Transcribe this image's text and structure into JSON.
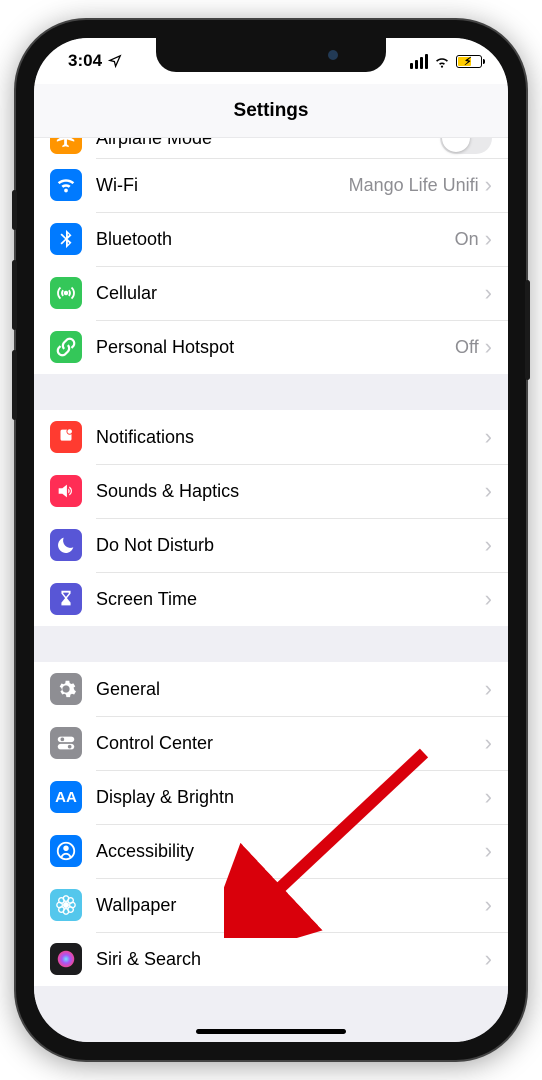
{
  "status": {
    "time": "3:04"
  },
  "nav": {
    "title": "Settings"
  },
  "groups": [
    {
      "rows": [
        {
          "id": "airplane-mode",
          "label": "Airplane Mode",
          "icon": "airplane",
          "bg": "#ff9500",
          "type": "toggle",
          "toggle_on": false,
          "cut": "top"
        },
        {
          "id": "wifi",
          "label": "Wi-Fi",
          "icon": "wifi",
          "bg": "#007aff",
          "type": "nav",
          "value": "Mango Life Unifi"
        },
        {
          "id": "bluetooth",
          "label": "Bluetooth",
          "icon": "bluetooth",
          "bg": "#007aff",
          "type": "nav",
          "value": "On"
        },
        {
          "id": "cellular",
          "label": "Cellular",
          "icon": "antenna",
          "bg": "#34c759",
          "type": "nav",
          "value": ""
        },
        {
          "id": "hotspot",
          "label": "Personal Hotspot",
          "icon": "link",
          "bg": "#34c759",
          "type": "nav",
          "value": "Off"
        }
      ]
    },
    {
      "rows": [
        {
          "id": "notifications",
          "label": "Notifications",
          "icon": "bell",
          "bg": "#ff3b30",
          "type": "nav",
          "value": ""
        },
        {
          "id": "sounds",
          "label": "Sounds & Haptics",
          "icon": "speaker",
          "bg": "#ff2d55",
          "type": "nav",
          "value": ""
        },
        {
          "id": "dnd",
          "label": "Do Not Disturb",
          "icon": "moon",
          "bg": "#5856d6",
          "type": "nav",
          "value": ""
        },
        {
          "id": "screen-time",
          "label": "Screen Time",
          "icon": "hourglass",
          "bg": "#5856d6",
          "type": "nav",
          "value": ""
        }
      ]
    },
    {
      "rows": [
        {
          "id": "general",
          "label": "General",
          "icon": "gear",
          "bg": "#8e8e93",
          "type": "nav",
          "value": ""
        },
        {
          "id": "control-center",
          "label": "Control Center",
          "icon": "switches",
          "bg": "#8e8e93",
          "type": "nav",
          "value": ""
        },
        {
          "id": "display",
          "label": "Display & Brightn",
          "icon": "aa",
          "bg": "#007aff",
          "type": "nav",
          "value": ""
        },
        {
          "id": "accessibility",
          "label": "Accessibility",
          "icon": "person-circle",
          "bg": "#007aff",
          "type": "nav",
          "value": ""
        },
        {
          "id": "wallpaper",
          "label": "Wallpaper",
          "icon": "flower",
          "bg": "#54c7ec",
          "type": "nav",
          "value": ""
        },
        {
          "id": "siri",
          "label": "Siri & Search",
          "icon": "siri",
          "bg": "#1c1c1e",
          "type": "nav",
          "value": "",
          "cut": "bottom"
        }
      ]
    }
  ],
  "annotation": {
    "target": "accessibility"
  }
}
